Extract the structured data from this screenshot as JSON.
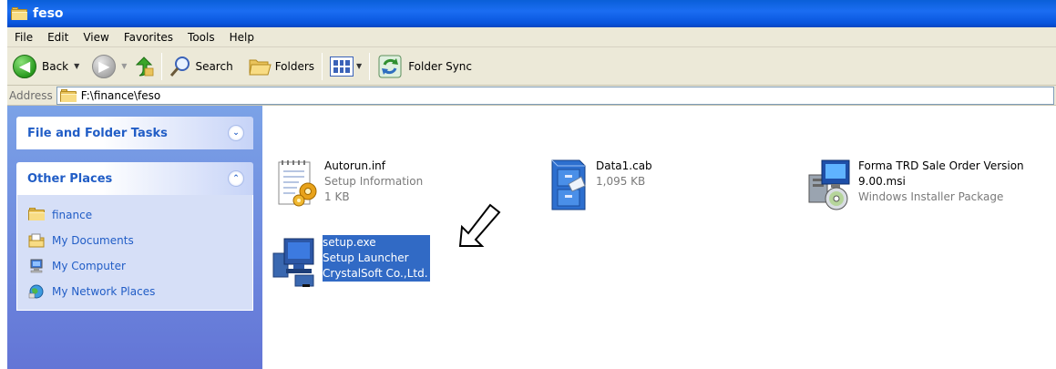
{
  "window": {
    "title": "feso"
  },
  "menu": [
    "File",
    "Edit",
    "View",
    "Favorites",
    "Tools",
    "Help"
  ],
  "toolbar": {
    "back_label": "Back",
    "search_label": "Search",
    "folders_label": "Folders",
    "folder_sync_label": "Folder Sync"
  },
  "address": {
    "label": "Address",
    "path": "F:\\finance\\feso"
  },
  "taskpane": {
    "file_tasks_title": "File and Folder Tasks",
    "other_places_title": "Other Places",
    "places": [
      "finance",
      "My Documents",
      "My Computer",
      "My Network Places"
    ]
  },
  "files": [
    {
      "name": "Autorun.inf",
      "type": "Setup Information",
      "size": "1 KB",
      "icon": "inf-file-icon"
    },
    {
      "name": "Data1.cab",
      "type": "",
      "size": "1,095 KB",
      "icon": "cabinet-file-icon"
    },
    {
      "name": "Forma TRD Sale Order Version",
      "name2": "9.00.msi",
      "type": "Windows Installer Package",
      "icon": "msi-installer-icon"
    },
    {
      "name": "setup.exe",
      "type": "Setup Launcher",
      "company": "CrystalSoft Co.,Ltd.",
      "icon": "setup-exe-icon",
      "selected": true
    }
  ],
  "colors": {
    "title_bar": "#0a5fd8",
    "selection": "#316ac5",
    "task_link": "#215dc6"
  }
}
